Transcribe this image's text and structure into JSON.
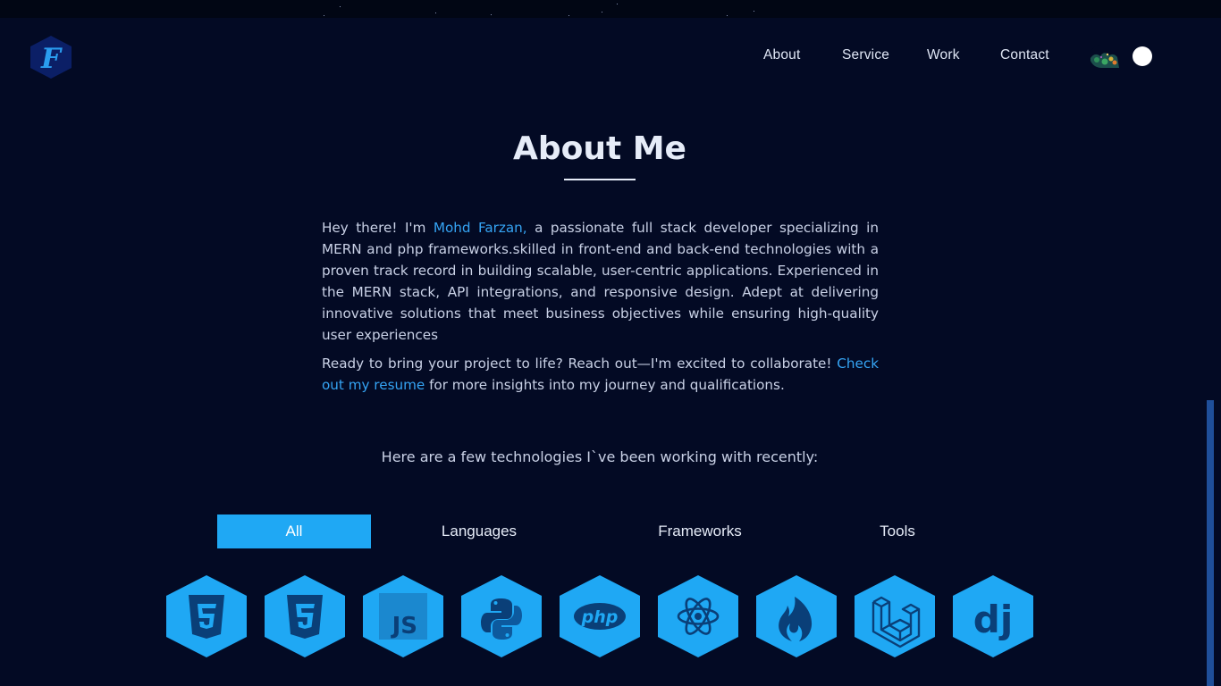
{
  "nav": {
    "logo_letter": "F",
    "links": [
      "About",
      "Service",
      "Work",
      "Contact"
    ]
  },
  "about": {
    "title": "About Me",
    "p1_before": "Hey there! I'm ",
    "name": "Mohd Farzan,",
    "p1_after": " a passionate full stack developer specializing in MERN and php frameworks.skilled in front-end and back-end technologies with a proven track record in building scalable, user-centric applications. Experienced in the MERN stack, API integrations, and responsive design. Adept at delivering innovative solutions that meet business objectives while ensuring high-quality user experiences",
    "p2_before": "Ready to bring your project to life? Reach out—I'm excited to collaborate! ",
    "resume_link": "Check out my resume",
    "p2_after": " for more insights into my journey and qualifications."
  },
  "tech": {
    "intro": "Here are a few technologies I`ve been working with recently:",
    "tabs": [
      "All",
      "Languages",
      "Frameworks",
      "Tools"
    ],
    "active_tab": "All",
    "icons": [
      "html5-icon",
      "css3-icon",
      "javascript-icon",
      "python-icon",
      "php-icon",
      "react-icon",
      "codeigniter-icon",
      "laravel-icon",
      "django-icon"
    ],
    "js_label": "JS",
    "php_label": "php",
    "django_label": "dj"
  },
  "colors": {
    "background": "#030a24",
    "accent": "#1fa8f4",
    "link": "#35a4f4",
    "icon_dark": "#0a3f78"
  }
}
